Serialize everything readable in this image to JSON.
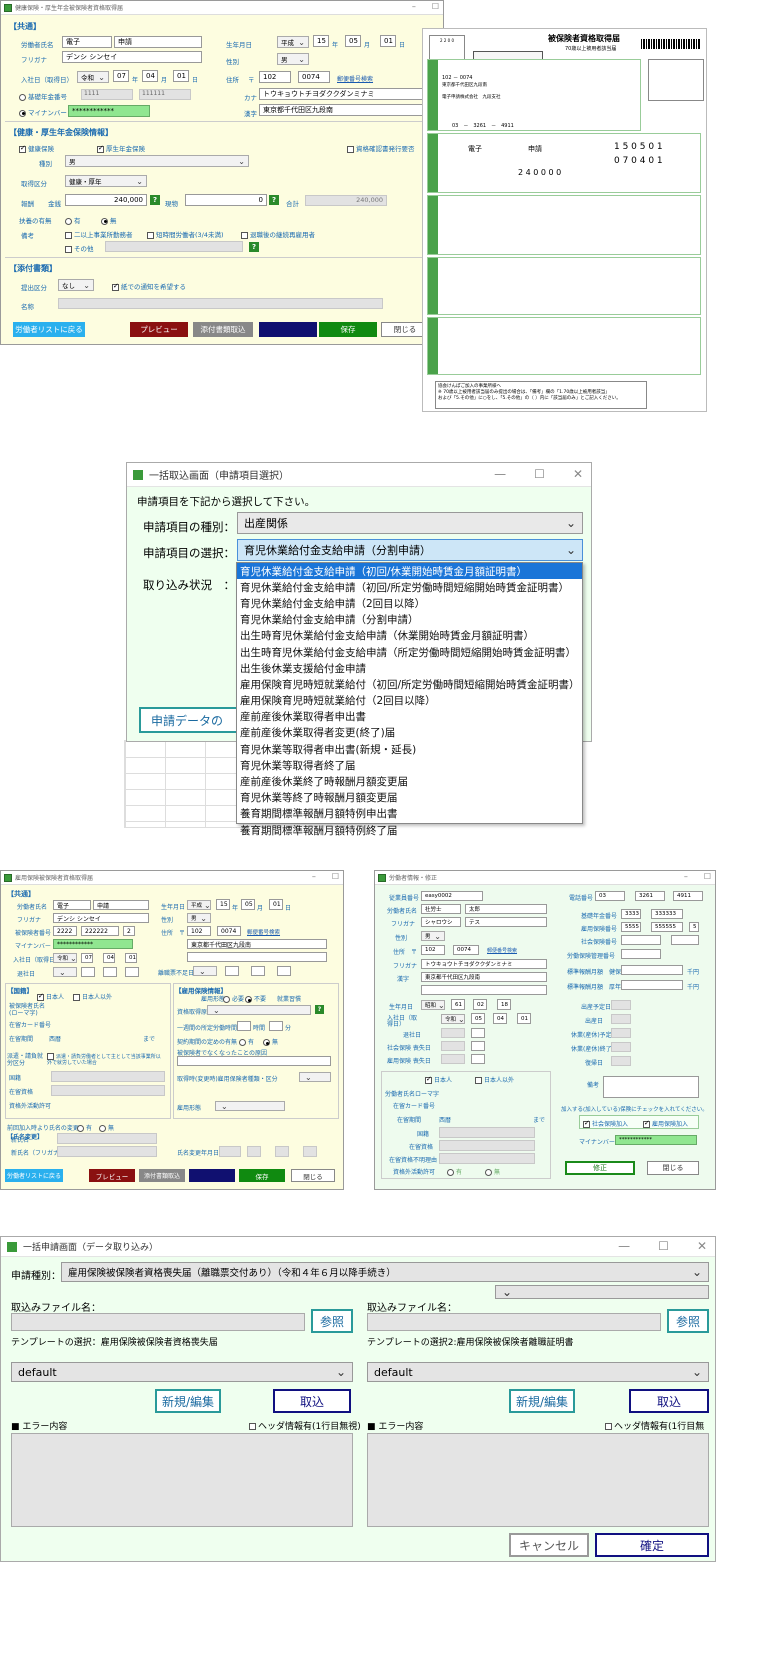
{
  "s1": {
    "title": "健康保険・厚生年金被保険者資格取得届",
    "common": "【共通】",
    "name_label": "労働者氏名",
    "name_last": "電子",
    "name_first": "申請",
    "kana_label": "フリガナ",
    "kana_value": "デンシ シンセイ",
    "birth_label": "生年月日",
    "era1": "平成",
    "b_y": "15",
    "b_m": "05",
    "b_d": "01",
    "u_y": "年",
    "u_m": "月",
    "u_d": "日",
    "gender_label": "性別",
    "gender": "男",
    "join_label": "入社日（取得日）",
    "era2": "令和",
    "j_y": "07",
    "j_m": "04",
    "j_d": "01",
    "addr_label": "住所",
    "zip_mark": "〒",
    "zip1": "102",
    "zip2": "0074",
    "zip_link": "郵便番号検索",
    "pension_label": "基礎年金番号",
    "pension1": "1111",
    "pension2": "111111",
    "kana_addr_label": "カナ",
    "kana_addr": "トウキョウトチヨダククダンミナミ",
    "mynumber_label": "マイナンバー",
    "mynumber": "************",
    "kanji_label": "漢字",
    "addr": "東京都千代田区九段南",
    "health_sec": "【健康・厚生年金保険情報】",
    "health_ins": "健康保険",
    "welfare_ins": "厚生年金保険",
    "qual_label": "資格確認書発行要否",
    "kind_label": "種別",
    "kind": "男",
    "category_label": "取得区分",
    "category": "健康・厚年",
    "salary_label": "報酬",
    "money_label": "金銭",
    "money": "240,000",
    "goods_label": "現物",
    "goods": "0",
    "total_label": "合計",
    "total": "240,000",
    "dep_label": "扶養の有無",
    "dep_yes": "有",
    "dep_no": "無",
    "note_label": "備考",
    "note1": "二以上事業所勤務者",
    "note2": "短時間労働者(3/4未満)",
    "note3": "退職後の継続再雇用者",
    "note4": "その他",
    "attach_sec": "【添付書類】",
    "submit_label": "提出区分",
    "submit": "なし",
    "paper_label": "紙での通知を希望する",
    "fname_label": "名称",
    "b_list": "労働者リストに戻る",
    "b_prev": "プレビュー",
    "b_attach": "添付書類取込",
    "b_save": "保存",
    "b_close": "閉じる"
  },
  "form": {
    "t1": "被保険者資格取得届",
    "t2": "70歳以上被用者該当届",
    "code": "2 2 0 0",
    "n1": "1 5 0 5 0 1",
    "n2": "0 7 0 4 0 1",
    "n3": "2 4 0 0 0 0",
    "nm1": "電子",
    "nm2": "申請",
    "zip": "102 － 0074",
    "addr": "東京都千代田区九段南",
    "tel": "03　－　3261　－　4911",
    "office": "電子申請株式会社　九段支社",
    "foot1": "協会けんぽご加入の事業所様へ",
    "foot2": "※ 70歳以上被用者該当届のみ提出の場合は、「備考」欄の「1.70歳以上被用者該当」",
    "foot3": "および「5.その他」に○をし、「5.その他」の（ ）内に「該当届のみ」とご記入ください。"
  },
  "dlg1": {
    "title": "一括取込画面（申請項目選択）",
    "prompt": "申請項目を下記から選択して下さい。",
    "kind_label": "申請項目の種別：",
    "kind_value": "出産関係",
    "sel_label": "申請項目の選択：",
    "sel_value": "育児休業給付金支給申請（分割申請）",
    "status_label": "取り込み状況　：",
    "data_btn": "申請データの",
    "items": [
      "育児休業給付金支給申請（初回/休業開始時賃金月額証明書）",
      "育児休業給付金支給申請（初回/所定労働時間短縮開始時賃金証明書）",
      "育児休業給付金支給申請（2回目以降）",
      "育児休業給付金支給申請（分割申請）",
      "出生時育児休業給付金支給申請（休業開始時賃金月額証明書）",
      "出生時育児休業給付金支給申請（所定労働時間短縮開始時賃金証明書）",
      "出生後休業支援給付金申請",
      "雇用保険育児時短就業給付（初回/所定労働時間短縮開始時賃金証明書）",
      "雇用保険育児時短就業給付（2回目以降）",
      "産前産後休業取得者申出書",
      "産前産後休業取得者変更(終了)届",
      "育児休業等取得者申出書(新規・延長)",
      "育児休業等取得者終了届",
      "産前産後休業終了時報酬月額変更届",
      "育児休業等終了時報酬月額変更届",
      "養育期間標準報酬月額特例申出書",
      "養育期間標準報酬月額特例終了届"
    ]
  },
  "s3": {
    "title": "雇用保険被保険者資格取得届",
    "common": "【共通】",
    "name_label": "労働者氏名",
    "name_last": "電子",
    "name_first": "申請",
    "kana_label": "フリガナ",
    "kana_value": "デンシ シンセイ",
    "ins_label": "被保険者番号",
    "ins1": "2222",
    "ins2": "222222",
    "ins3": "2",
    "my_label": "マイナンバー",
    "mynumber": "************",
    "join_label": "入社日（取得日）",
    "era": "令和",
    "j_y": "07",
    "j_m": "04",
    "j_d": "01",
    "leave_label": "退社日",
    "birth_label": "生年月日",
    "era1": "平成",
    "b_y": "15",
    "b_m": "05",
    "b_d": "01",
    "gender_label": "性別",
    "gender": "男",
    "addr_label": "住所",
    "zip_mark": "〒",
    "zip1": "102",
    "zip2": "0074",
    "zip_link": "郵便番号検索",
    "addr": "東京都千代田区九段南",
    "u_y": "年",
    "u_m": "月",
    "u_d": "日",
    "prev_label": "離職票不足日",
    "nat_sec": "【国籍】",
    "jp": "日本人",
    "nonjp": "日本人以外",
    "roma_label": "被保険者氏名(ローマ字)",
    "card_label": "在留カード番号",
    "period_label": "在留期間",
    "western": "西暦",
    "until": "まで",
    "dispatch_label": "派遣・請負就労区分",
    "dispatch_text": "派遣・請負労働者として主として当該事業所以外で就労していた場合",
    "country_label": "国籍",
    "status_label": "在留資格",
    "permit_label": "資格外活動許可",
    "emp_sec": "【雇用保険情報】",
    "emp_type": "雇用形態",
    "need": "必要",
    "noneed": "不要",
    "worktype": "就業習慣",
    "cause_label": "資格取得原因",
    "weekly_label": "一週間の所定労働時間",
    "hours": "時間",
    "minutes": "分",
    "contract_label": "契約期間の定めの有無",
    "yes": "有",
    "no": "無",
    "reason_label": "被保険者でなくなったことの原因",
    "kind_label": "取得時(変更時)雇用保険者種類・区分",
    "job_label": "雇用形態",
    "change_label": "前回加入時より氏名の変更",
    "change_yes": "有",
    "change_no": "無",
    "change_sec": "【氏名変更】",
    "new_name": "新氏名",
    "new_kana": "新氏名（フリガナ）",
    "change_date": "氏名変更年月日",
    "b_list": "労働者リストに戻る",
    "b_prev": "プレビュー",
    "b_attach": "添付書類取込",
    "b_save": "保存",
    "b_close": "閉じる"
  },
  "s4": {
    "title": "労働者情報・修正",
    "emp_no_label": "従業員番号",
    "emp_no": "easy0002",
    "name_label": "労働者氏名",
    "name_last": "社労士",
    "name_first": "太郎",
    "kana_label": "フリガナ",
    "kana_last": "シャロウシ",
    "kana_first": "テス",
    "gender_label": "性別",
    "gender": "男",
    "addr_label": "住所",
    "zip_mark": "〒",
    "zip1": "102",
    "zip2": "0074",
    "zip_link": "郵便番号検索",
    "kana_addr_label": "フリガナ",
    "kana_addr": "トウキョウトチヨダククダンミナミ",
    "kanji_label": "漢字",
    "addr": "東京都千代田区九段南",
    "birth_label": "生年月日",
    "era": "昭和",
    "b_y": "61",
    "b_m": "02",
    "b_d": "18",
    "join_label": "入社日（取得日）",
    "era2": "令和",
    "j_y": "05",
    "j_m": "04",
    "j_d": "01",
    "leave_label": "退社日",
    "soc_label": "社会保険 喪失日",
    "emp_label": "雇用保険 喪失日",
    "u_y": "年",
    "u_m": "月",
    "u_d": "日",
    "jp": "日本人",
    "nonjp": "日本人以外",
    "roma_label": "労働者氏名ローマ字",
    "card_label": "在留カード番号",
    "period_label": "在留期間",
    "western": "西暦",
    "until": "まで",
    "country_label": "国籍",
    "status_label": "在留資格",
    "nonstatus_label": "在留資格不明理由",
    "permit_label": "資格外活動許可",
    "permit_yes": "有",
    "permit_no": "無",
    "tel_label": "電話番号",
    "tel1": "03",
    "tel2": "3261",
    "tel3": "4911",
    "basic_label": "基礎年金番号",
    "basic1": "3333",
    "basic2": "333333",
    "empins_label": "雇用保険番号",
    "empins1": "5555",
    "empins2": "555555",
    "empins3": "5",
    "soc_no_label": "社会保険番号",
    "soc_mgmt_label": "労働保険管理番号",
    "std_h_label": "標準報酬月額　健保",
    "std_p_label": "標準報酬月額　厚年",
    "yen": "千円",
    "birth_due_label": "出産予定日",
    "birth_date_label": "出産日",
    "leave_due_label": "休業(産休)予定日",
    "leave_end_label": "休業(産休)終了",
    "return_label": "復帰日",
    "memo_label": "備考",
    "check_note": "加入する(加入している)保険にチェックを入れてください。",
    "soc_join": "社会保険加入",
    "emp_join": "雇用保険加入",
    "my_label": "マイナンバー",
    "mynumber": "************",
    "b_fix": "修正",
    "b_close": "閉じる"
  },
  "dlg5": {
    "title": "一括申請画面（データ取り込み）",
    "kind_label": "申請種別：",
    "kind_value": "雇用保険被保険者資格喪失届（離職票交付あり）（令和４年６月以降手続き）",
    "file_label": "取込みファイル名：",
    "ref": "参照",
    "tmpl1_label": "テンプレートの選択：",
    "tmpl1_name": "雇用保険被保険者資格喪失届",
    "tmpl2_label": "テンプレートの選択2:",
    "tmpl2_name": "雇用保険被保険者離職証明書",
    "default": "default",
    "new_edit": "新規/編集",
    "import": "取込",
    "err_label": "■ エラー内容",
    "header_label": "ヘッダ情報有(1行目無視)",
    "cancel": "キャンセル",
    "ok": "確定"
  },
  "colors": {
    "accent": "#1a6ab0",
    "green": "#2a8a2a",
    "yellow_bg": "#fdfde0",
    "mint_bg": "#efffef",
    "highlight": "#1a75d8"
  }
}
